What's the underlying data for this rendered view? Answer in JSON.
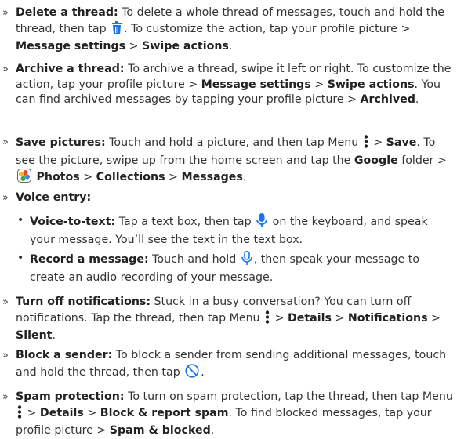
{
  "icons": {
    "trash": "trash-icon",
    "menu": "menu-icon",
    "photos": "photos-app-icon",
    "mic": "microphone-icon",
    "block": "block-icon",
    "accent": "#1a73e8"
  },
  "items": {
    "delete": {
      "title": "Delete a thread:",
      "t1": " To delete a whole thread of messages, touch and hold the thread, then tap ",
      "t2": ". To customize the action, tap your profile picture > ",
      "b1": "Message settings",
      "t3": " > ",
      "b2": "Swipe actions",
      "t4": "."
    },
    "archive": {
      "title": "Archive a thread:",
      "t1": " To archive a thread, swipe it left or right. To customize the action, tap your profile picture > ",
      "b1": "Message settings",
      "t2": " > ",
      "b2": "Swipe actions",
      "t3": ". You can find archived messages by tapping your profile picture > ",
      "b3": "Archived",
      "t4": "."
    },
    "save": {
      "title": "Save pictures:",
      "t1": " Touch and hold a picture, and then tap Menu ",
      "t2": " > ",
      "b1": "Save",
      "t3": ". To see the picture, swipe up from the home screen and tap the ",
      "b2": "Google",
      "t4": " folder > ",
      "b3": "Photos",
      "t5": " > ",
      "b4": "Collections",
      "t6": " > ",
      "b5": "Messages",
      "t7": "."
    },
    "voice": {
      "title": "Voice entry:",
      "vtt_title": "Voice-to-text:",
      "vtt_t1": " Tap a text box, then tap ",
      "vtt_t2": " on the keyboard, and speak your message. You’ll see the text in the text box.",
      "rec_title": "Record a message:",
      "rec_t1": " Touch and hold ",
      "rec_t2": ", then speak your message to create an audio recording of your message."
    },
    "notif": {
      "title": "Turn off notifications:",
      "t1": " Stuck in a busy conversation? You can turn off notifications. Tap the thread, then tap Menu ",
      "t2": " > ",
      "b1": "Details",
      "t3": " > ",
      "b2": "Notifications",
      "t4": " > ",
      "b3": "Silent",
      "t5": "."
    },
    "block": {
      "title": "Block a sender:",
      "t1": " To block a sender from sending additional messages, touch and hold the thread, then tap ",
      "t2": "."
    },
    "spam": {
      "title": "Spam protection:",
      "t1": " To turn on spam protection, tap the thread, then tap Menu ",
      "t2": " > ",
      "b1": "Details",
      "t3": " > ",
      "b2": "Block & report spam",
      "t4": ". To find blocked messages, tap your profile picture > ",
      "b3": "Spam & blocked",
      "t5": "."
    }
  }
}
